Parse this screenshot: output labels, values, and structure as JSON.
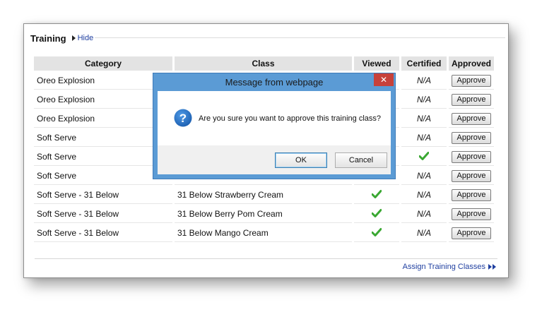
{
  "panel": {
    "title": "Training",
    "toggle_label": "Hide"
  },
  "table": {
    "headers": [
      "Category",
      "Class",
      "Viewed",
      "Certified",
      "Approved"
    ],
    "rows": [
      {
        "category": "Oreo Explosion",
        "class": "",
        "viewed": false,
        "certified": "N/A",
        "approve_label": "Approve"
      },
      {
        "category": "Oreo Explosion",
        "class": "",
        "viewed": false,
        "certified": "N/A",
        "approve_label": "Approve"
      },
      {
        "category": "Oreo Explosion",
        "class": "",
        "viewed": false,
        "certified": "N/A",
        "approve_label": "Approve"
      },
      {
        "category": "Soft Serve",
        "class": "",
        "viewed": false,
        "certified": "N/A",
        "approve_label": "Approve"
      },
      {
        "category": "Soft Serve",
        "class": "",
        "viewed": false,
        "certified": "",
        "certified_check": true,
        "approve_label": "Approve"
      },
      {
        "category": "Soft Serve",
        "class": "",
        "viewed": false,
        "certified": "N/A",
        "approve_label": "Approve"
      },
      {
        "category": "Soft Serve - 31 Below",
        "class": "31 Below Strawberry Cream",
        "viewed": true,
        "certified": "N/A",
        "approve_label": "Approve"
      },
      {
        "category": "Soft Serve - 31 Below",
        "class": "31 Below Berry Pom Cream",
        "viewed": true,
        "certified": "N/A",
        "approve_label": "Approve"
      },
      {
        "category": "Soft Serve - 31 Below",
        "class": "31 Below Mango Cream",
        "viewed": true,
        "certified": "N/A",
        "approve_label": "Approve"
      }
    ]
  },
  "footer": {
    "assign_link": "Assign Training Classes"
  },
  "dialog": {
    "title": "Message from webpage",
    "close_glyph": "✕",
    "message": "Are you sure you want to approve this training class?",
    "ok_label": "OK",
    "cancel_label": "Cancel",
    "icon": "question-icon"
  },
  "colors": {
    "accent_link": "#1f3fa0",
    "dialog_frame": "#5b9bd5",
    "close_red": "#c7413a",
    "check_green": "#3aa832"
  }
}
